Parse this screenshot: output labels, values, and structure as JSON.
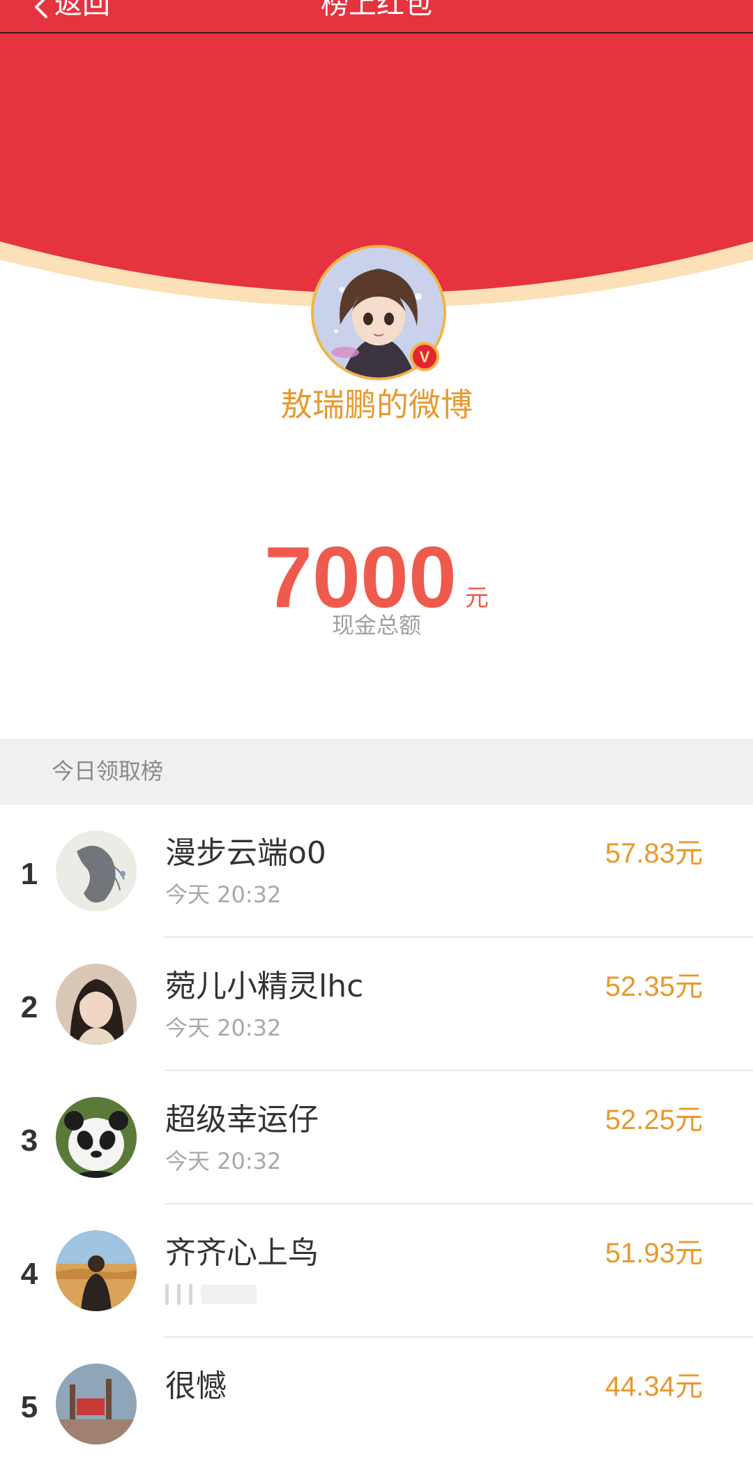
{
  "nav": {
    "back_label": "返回",
    "title": "榜上红包"
  },
  "colors": {
    "header_red": "#e5333f",
    "header_border": "#fbe0b8",
    "name_orange": "#e79a2f",
    "amount_red": "#ef5a4e",
    "row_amount_orange": "#e8982d"
  },
  "sender": {
    "name": "敖瑞鹏的微博",
    "verified_icon": "verified-v-badge"
  },
  "amount": {
    "value": "7000",
    "unit": "元",
    "label": "现金总额"
  },
  "leaderboard": {
    "title": "今日领取榜",
    "rows": [
      {
        "rank": "1",
        "name": "漫步云端o0",
        "time": "今天 20:32",
        "amount": "57.83元"
      },
      {
        "rank": "2",
        "name": "菀儿小精灵lhc",
        "time": "今天 20:32",
        "amount": "52.35元"
      },
      {
        "rank": "3",
        "name": "超级幸运仔",
        "time": "今天 20:32",
        "amount": "52.25元"
      },
      {
        "rank": "4",
        "name": "齐齐心上鸟",
        "time": "",
        "amount": "51.93元"
      },
      {
        "rank": "5",
        "name": "很憾",
        "time": "",
        "amount": "44.34元"
      }
    ]
  }
}
